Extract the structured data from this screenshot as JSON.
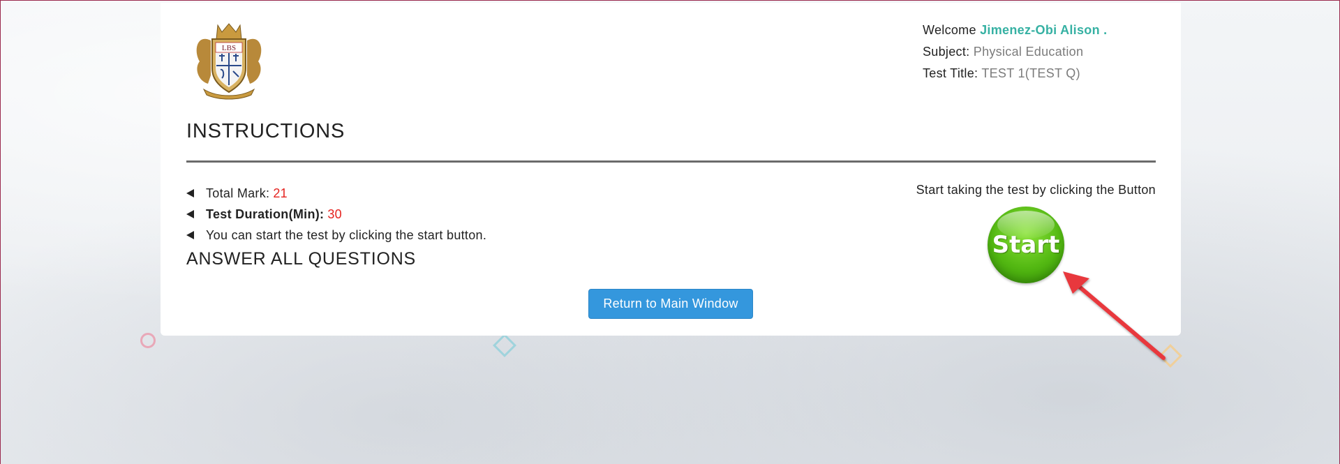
{
  "header": {
    "welcome_label": "Welcome",
    "user_name": "Jimenez-Obi Alison .",
    "subject_label": "Subject:",
    "subject_value": "Physical Education",
    "test_title_label": "Test Title:",
    "test_title_value": "TEST 1(TEST Q)",
    "logo_text": "LBS",
    "logo_icon": "school-crest"
  },
  "instructions": {
    "heading": "INSTRUCTIONS",
    "total_mark_label": "Total Mark:",
    "total_mark_value": "21",
    "duration_label": "Test Duration(Min):",
    "duration_value": "30",
    "start_note": "You can start the test by clicking the start button.",
    "answer_all": "ANSWER ALL QUESTIONS"
  },
  "start_panel": {
    "caption": "Start taking the test by clicking the Button",
    "start_label": "Start"
  },
  "actions": {
    "return_label": "Return to Main Window"
  },
  "colors": {
    "accent_name": "#36b1a3",
    "value_red": "#e5231f",
    "button_blue": "#3497dd",
    "start_green": "#53b812",
    "arrow_red": "#e8383d"
  }
}
